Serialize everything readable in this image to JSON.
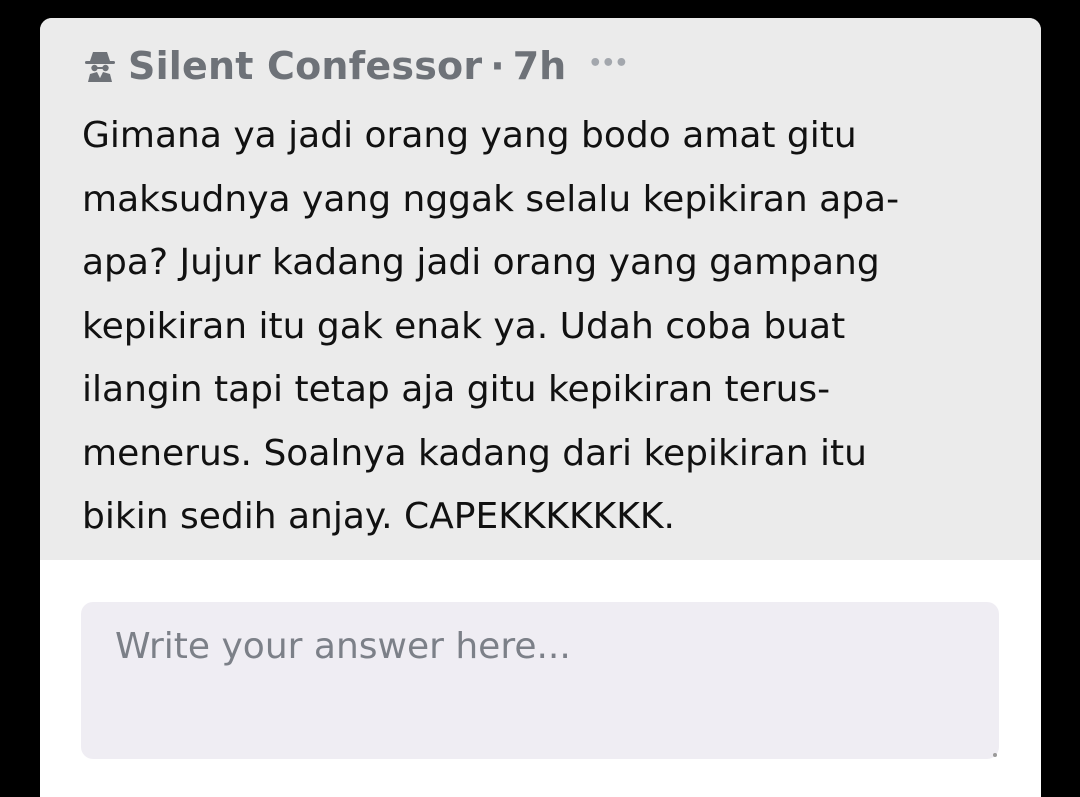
{
  "post": {
    "author": "Silent Confessor",
    "separator": "·",
    "time": "7h",
    "more_label": "•••",
    "author_icon": "spy-icon",
    "body_lines": "Gimana ya jadi orang yang bodo amat gitu\nmaksudnya yang nggak selalu kepikiran apa-\napa? Jujur kadang jadi orang yang gampang\nkepikiran itu gak enak ya. Udah coba buat\nilangin tapi tetap aja gitu kepikiran terus-\nmenerus. Soalnya kadang dari kepikiran itu\nbikin sedih anjay. CAPEKKKKKKK."
  },
  "answer": {
    "value": "",
    "placeholder": "Write your answer here..."
  },
  "colors": {
    "page_background": "#000000",
    "question_background": "#ebebeb",
    "answer_background": "#efedf3",
    "meta_text": "#6e7278"
  }
}
